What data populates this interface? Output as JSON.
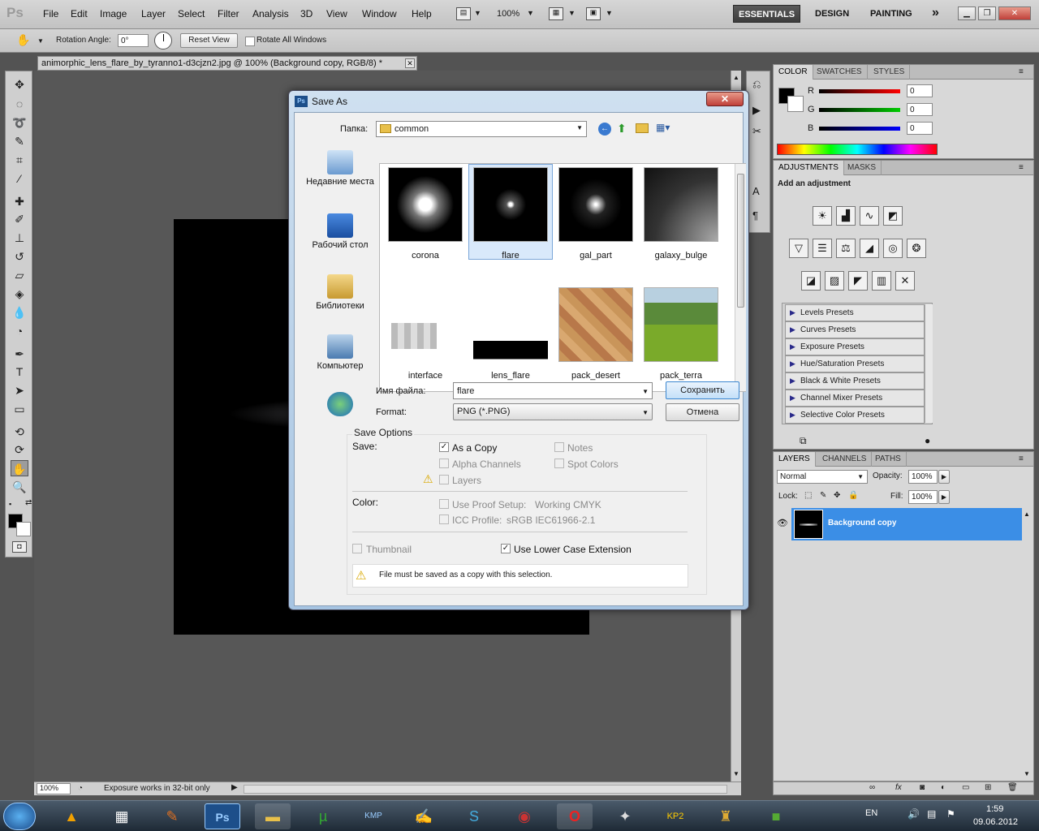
{
  "app": {
    "logo": "Ps",
    "menu": [
      "File",
      "Edit",
      "Image",
      "Layer",
      "Select",
      "Filter",
      "Analysis",
      "3D",
      "View",
      "Window",
      "Help"
    ],
    "zoom": "100%",
    "workspaces": [
      "ESSENTIALS",
      "DESIGN",
      "PAINTING"
    ],
    "more": "»"
  },
  "options": {
    "rotation_label": "Rotation Angle:",
    "rotation_value": "0°",
    "reset_view": "Reset View",
    "rotate_all": "Rotate All Windows"
  },
  "document": {
    "tab_title": "animorphic_lens_flare_by_tyranno1-d3cjzn2.jpg @ 100% (Background copy, RGB/8) *",
    "status_zoom": "100%",
    "status_text": "Exposure works in 32-bit only"
  },
  "color_panel": {
    "tabs": [
      "COLOR",
      "SWATCHES",
      "STYLES"
    ],
    "channels": [
      {
        "name": "R",
        "value": "0"
      },
      {
        "name": "G",
        "value": "0"
      },
      {
        "name": "B",
        "value": "0"
      }
    ]
  },
  "adjustments_panel": {
    "tabs": [
      "ADJUSTMENTS",
      "MASKS"
    ],
    "heading": "Add an adjustment",
    "presets": [
      "Levels Presets",
      "Curves Presets",
      "Exposure Presets",
      "Hue/Saturation Presets",
      "Black & White Presets",
      "Channel Mixer Presets",
      "Selective Color Presets"
    ]
  },
  "layers_panel": {
    "tabs": [
      "LAYERS",
      "CHANNELS",
      "PATHS"
    ],
    "blend_mode": "Normal",
    "opacity_label": "Opacity:",
    "opacity_value": "100%",
    "lock_label": "Lock:",
    "fill_label": "Fill:",
    "fill_value": "100%",
    "layers": [
      {
        "name": "Background copy"
      }
    ]
  },
  "dialog": {
    "title": "Save As",
    "folder_label": "Папка:",
    "folder_value": "common",
    "places": [
      "Недавние места",
      "Рабочий стол",
      "Библиотеки",
      "Компьютер",
      ""
    ],
    "files": [
      {
        "name": "corona"
      },
      {
        "name": "flare"
      },
      {
        "name": "gal_part"
      },
      {
        "name": "galaxy_bulge"
      },
      {
        "name": "interface"
      },
      {
        "name": "lens_flare"
      },
      {
        "name": "pack_desert"
      },
      {
        "name": "pack_terra"
      }
    ],
    "filename_label": "Имя файла:",
    "filename_value": "flare",
    "format_label": "Format:",
    "format_value": "PNG (*.PNG)",
    "save_button": "Сохранить",
    "cancel_button": "Отмена",
    "save_options_title": "Save Options",
    "save_label": "Save:",
    "as_copy": "As a Copy",
    "notes": "Notes",
    "alpha": "Alpha Channels",
    "spot": "Spot Colors",
    "layers": "Layers",
    "color_label": "Color:",
    "proof": "Use Proof Setup:",
    "proof_value": "Working CMYK",
    "icc": "ICC Profile:",
    "icc_value": "sRGB IEC61966-2.1",
    "thumbnail": "Thumbnail",
    "lowercase": "Use Lower Case Extension",
    "warning": "File must be saved as a copy with this selection."
  },
  "taskbar": {
    "lang": "EN",
    "time": "1:59",
    "date": "09.06.2012"
  }
}
